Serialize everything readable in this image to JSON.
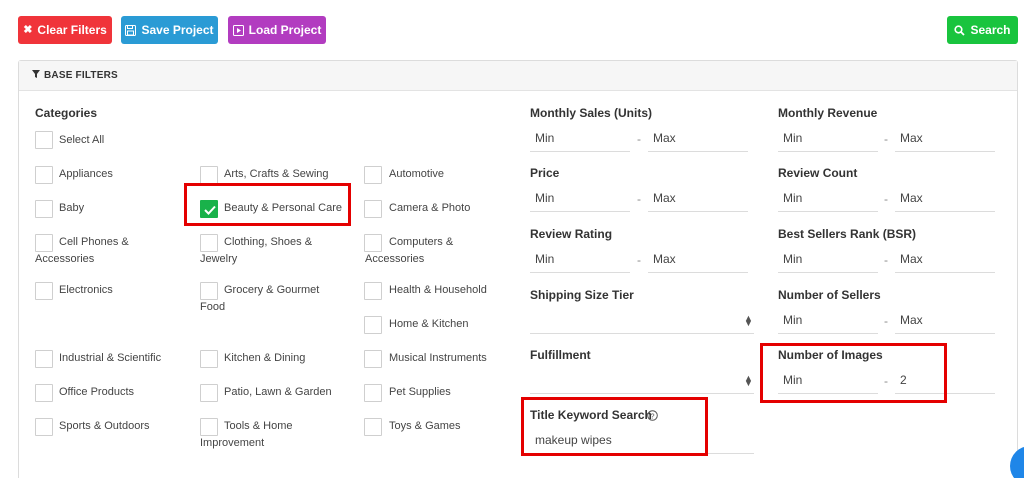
{
  "toolbar": {
    "clear_label": "Clear Filters",
    "save_label": "Save Project",
    "load_label": "Load Project",
    "search_label": "Search"
  },
  "panel": {
    "title": "BASE FILTERS"
  },
  "categories": {
    "heading": "Categories",
    "items": {
      "select_all": "Select All",
      "appliances": "Appliances",
      "arts": "Arts, Crafts & Sewing",
      "automotive": "Automotive",
      "baby": "Baby",
      "beauty": "Beauty & Personal Care",
      "camera": "Camera & Photo",
      "cell1": "Cell Phones &",
      "cell2": "Accessories",
      "clothing1": "Clothing, Shoes &",
      "clothing2": "Jewelry",
      "computers1": "Computers &",
      "computers2": "Accessories",
      "electronics": "Electronics",
      "grocery1": "Grocery & Gourmet",
      "grocery2": "Food",
      "health": "Health & Household",
      "home": "Home & Kitchen",
      "industrial": "Industrial & Scientific",
      "kitchen": "Kitchen & Dining",
      "musical": "Musical Instruments",
      "office": "Office Products",
      "patio": "Patio, Lawn & Garden",
      "pet": "Pet Supplies",
      "sports": "Sports & Outdoors",
      "tools1": "Tools & Home",
      "tools2": "Improvement",
      "toys": "Toys & Games"
    }
  },
  "filters": {
    "monthly_sales": {
      "label": "Monthly Sales (Units)",
      "min": "Min",
      "max": "Max"
    },
    "monthly_revenue": {
      "label": "Monthly Revenue",
      "min": "Min",
      "max": "Max"
    },
    "price": {
      "label": "Price",
      "min": "Min",
      "max": "Max"
    },
    "review_count": {
      "label": "Review Count",
      "min": "Min",
      "max": "Max"
    },
    "review_rating": {
      "label": "Review Rating",
      "min": "Min",
      "max": "Max"
    },
    "bsr": {
      "label": "Best Sellers Rank (BSR)",
      "min": "Min",
      "max": "Max"
    },
    "shipping": {
      "label": "Shipping Size Tier",
      "value": ""
    },
    "sellers": {
      "label": "Number of Sellers",
      "min": "Min",
      "max": "Max"
    },
    "fulfillment": {
      "label": "Fulfillment",
      "value": ""
    },
    "images": {
      "label": "Number of Images",
      "min": "Min",
      "max": "2"
    },
    "keyword": {
      "label": "Title Keyword Search",
      "value": "makeup wipes"
    }
  },
  "dash": "-",
  "colors": {
    "clear": "#f0343a",
    "save": "#2a9bd5",
    "load": "#b23cc0",
    "search": "#19c43e",
    "checked": "#19b24a",
    "highlight": "#e40000"
  }
}
